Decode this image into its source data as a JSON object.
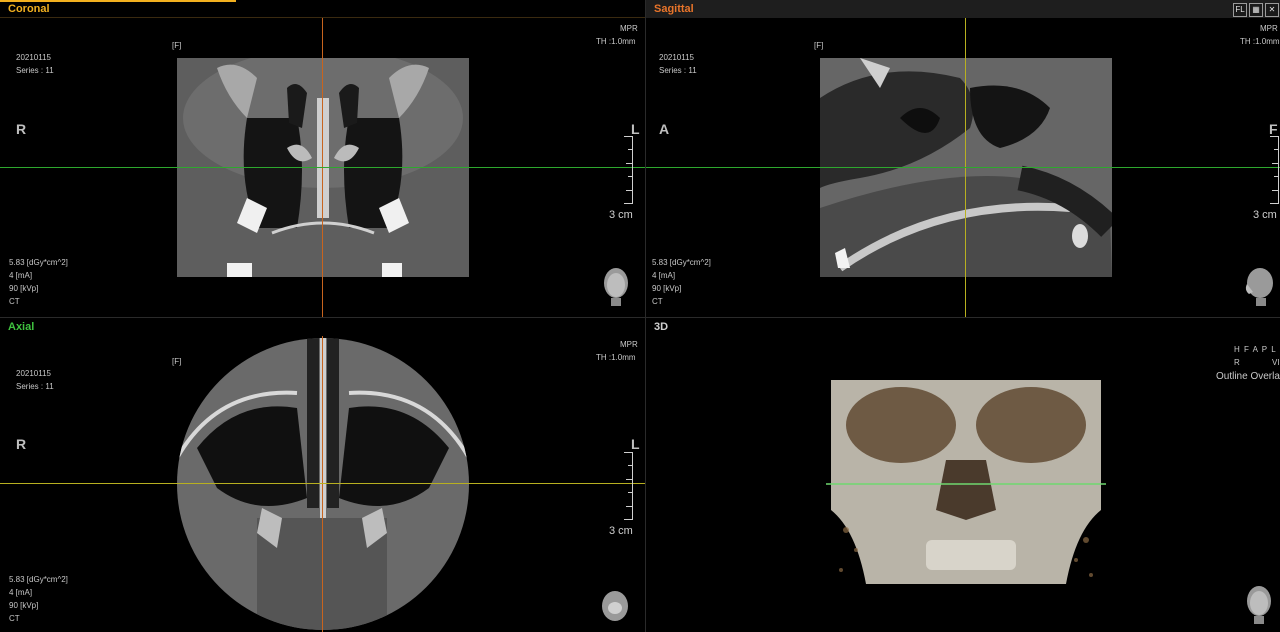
{
  "coronal": {
    "title": "Coronal",
    "title_color": "#f2b01f",
    "flag": "[F]",
    "mode": "MPR",
    "thickness": "TH :1.0mm",
    "date": "20210115",
    "series": "Series : 11",
    "orient_left": "R",
    "orient_right": "L",
    "scale": "3 cm",
    "dose": "5.83  [dGy*cm^2]",
    "ma": "4  [mA]",
    "kvp": "90 [kVp]",
    "modality": "CT"
  },
  "sagittal": {
    "title": "Sagittal",
    "title_color": "#e8742a",
    "flag": "[F]",
    "mode": "MPR",
    "thickness": "TH :1.0mm",
    "date": "20210115",
    "series": "Series : 11",
    "orient_left": "A",
    "orient_right": "F",
    "scale": "3 cm",
    "dose": "5.83  [dGy*cm^2]",
    "ma": "4  [mA]",
    "kvp": "90 [kVp]",
    "modality": "CT",
    "tools": [
      "FL",
      "▦",
      "✕"
    ]
  },
  "axial": {
    "title": "Axial",
    "title_color": "#3fc23f",
    "flag": "[F]",
    "mode": "MPR",
    "thickness": "TH :1.0mm",
    "date": "20210115",
    "series": "Series : 11",
    "orient_left": "R",
    "orient_right": "L",
    "scale": "3 cm",
    "dose": "5.83  [dGy*cm^2]",
    "ma": "4  [mA]",
    "kvp": "90 [kVp]",
    "modality": "CT"
  },
  "view3d": {
    "title": "3D",
    "title_color": "#d0d0d0",
    "orientation_letters": "H F A P L R",
    "vr_label": "VI",
    "overlay_label": "Outline Overla"
  },
  "colors": {
    "crosshair_orange": "#c8641e",
    "crosshair_green": "#2ea82e",
    "crosshair_yellow": "#b8b020"
  }
}
